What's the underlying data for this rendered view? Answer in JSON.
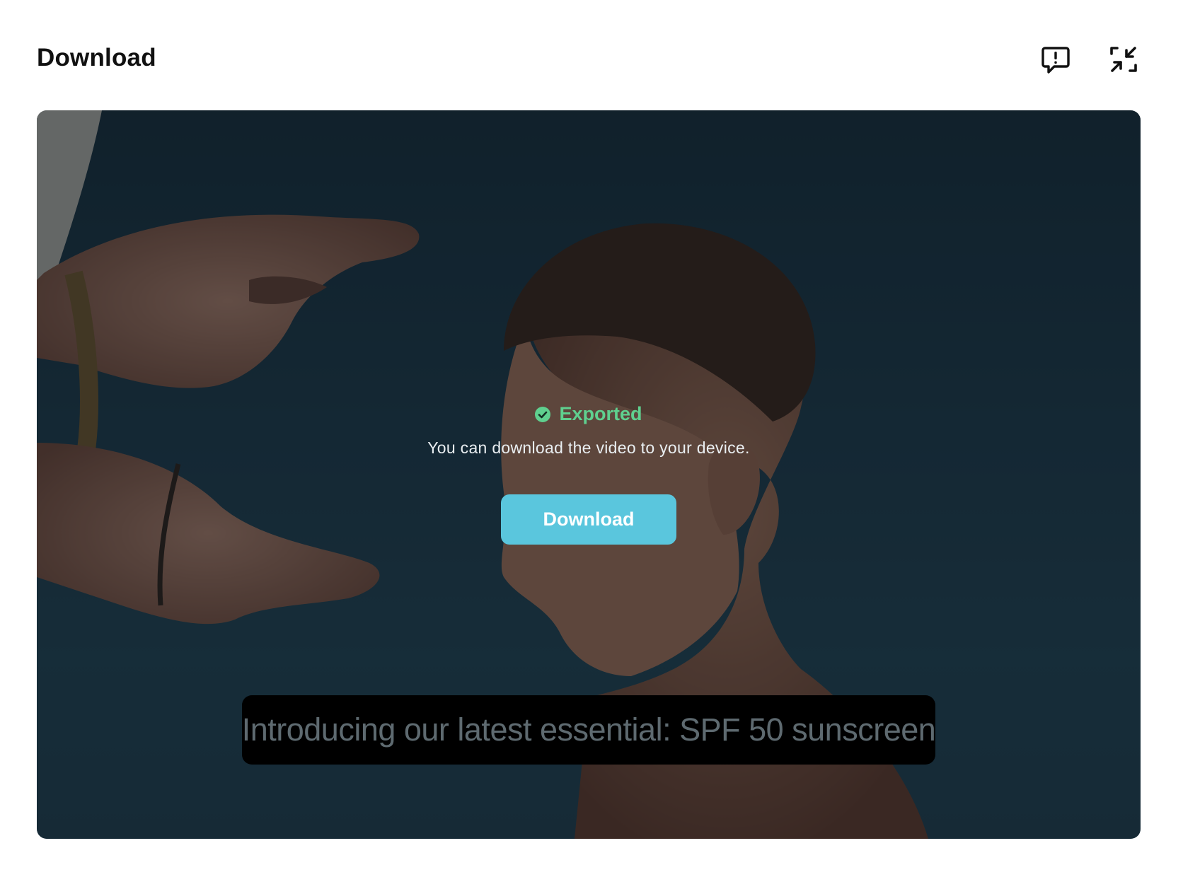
{
  "header": {
    "title": "Download",
    "feedback_icon": "feedback-icon",
    "collapse_icon": "collapse-icon"
  },
  "preview": {
    "status": {
      "label": "Exported",
      "icon": "check-circle-icon",
      "color": "#5fd08f",
      "description": "You can download the video to your device."
    },
    "download_button": {
      "label": "Download",
      "color": "#5ac6dd"
    },
    "caption": "Introducing our latest essential: SPF 50 sunscreen"
  }
}
